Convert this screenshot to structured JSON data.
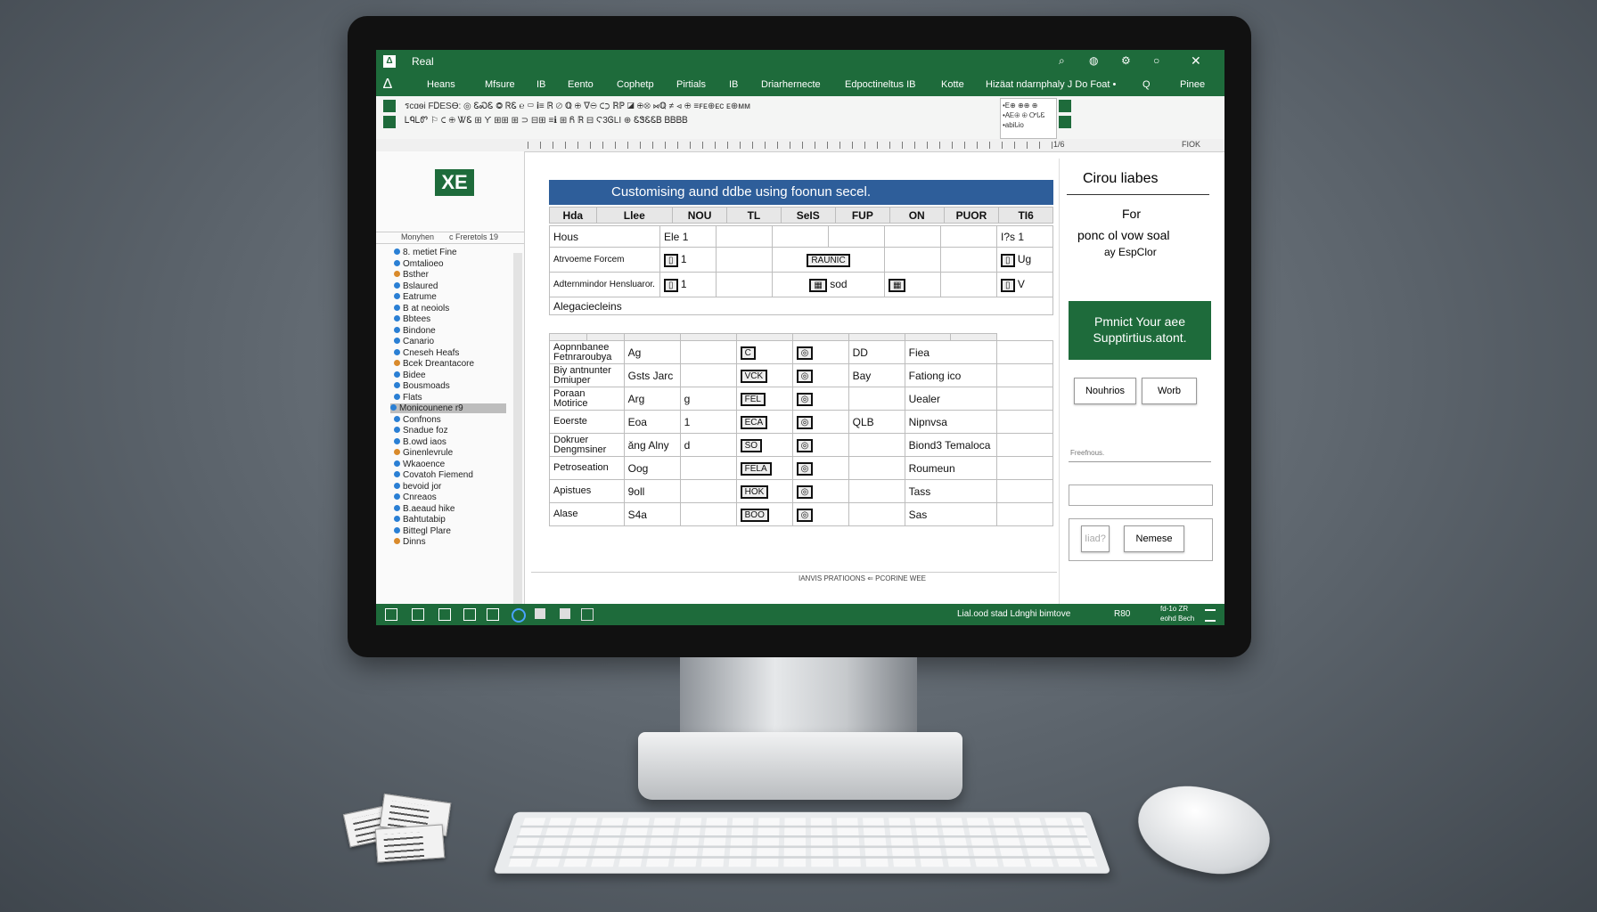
{
  "window": {
    "title": "Real"
  },
  "menu": [
    "Heans",
    "Mfsure",
    "IB",
    "Eento",
    "Cophetp",
    "Pirtials",
    "IB",
    "Driarhernecte",
    "Edpoctineltus IB",
    "Kotte",
    "Hizäat ndarnphaly J Do Foat •",
    "Q",
    "Pinee"
  ],
  "ribbon": {
    "row1": "รсɑѳі  FᎠESѲ:  ◎ ᏋᏍᏋ  ◎  ᏒᏋ  ℮  ▭  ℹ≡  ℝ  ⊘ ℚ  ⊕  ∇⊖  ⊂⊃  ℝℙ  ◪  ⊕⊗  ⋈ℚ  ≠  ⊲  ⊕  ≡ꜰᴇ⊕ᴇᴄ  ᴇ⊕ᴍᴍ",
    "row2": "ᏞᏄᏞᏛ  ⚐ ⊂  ⊕  ᏔᏋ  ⊞  ϒ  ⊞⊞  ⊞  ⊃  ⊟⊞  ≡ℹ  ⊞  Ᏺ  ℝ  ⊟  Ϛ3ᎶLI  ⊕  ᏋᏕᏋᏋᏴ  ᏴᏴᏴᏴ",
    "style_box": "•E⊕ ⊕⊕ ⊕\n•AᎬ⊕ ⊕ ᏅᏓᏋ\n•abiᏓio"
  },
  "ruler": {
    "right_label": "FIOK",
    "mid_label": "1/6"
  },
  "leftpane": {
    "logo": "XE",
    "header_left": "Monyhen",
    "header_right": "c Freretols 19",
    "items": [
      "8. metiet Fine",
      "Omtalioeo",
      "Bsther",
      "Bslaured",
      "Eatrume",
      "B at neoiols",
      "Bbtees",
      "Bindone",
      "Canario",
      "Cneseh Heafs",
      "Bcek Dreantacore",
      "Bidee",
      "Bousmoads",
      "Flats",
      "Monicounene r9",
      "Confnons",
      "Snadue foz",
      "B.owd iaos",
      "Ginenlevrule",
      "Wkaoence",
      "Covatoh Fiemend",
      "bevoid jor",
      "Cnreaos",
      "B.aeaud hike",
      "Bahtutabip",
      "Bittegl Plare",
      "Dinns"
    ]
  },
  "banner": "Customising aund ddbe using foonun secel.",
  "table1": {
    "headers": [
      "Hda",
      "Llee",
      "NOU",
      "TL",
      "SeIS",
      "FUP",
      "ON",
      "PUOR",
      "TI6"
    ],
    "rows": [
      [
        "Hous",
        "Ele",
        "1",
        "",
        "",
        "",
        "",
        "",
        "I?s",
        "1"
      ],
      [
        "Atrvoeme Forcem",
        "",
        "1",
        "RAUNIC",
        "",
        "",
        "",
        "",
        "",
        "Ug"
      ],
      [
        "Adternmindor Hensluaror.",
        "",
        "1",
        "",
        "sod",
        "",
        "",
        "",
        "",
        "V"
      ],
      [
        "Alegaciecleins",
        "",
        "",
        "",
        "",
        "",
        "",
        "",
        "",
        ""
      ]
    ]
  },
  "table2": {
    "rows": [
      [
        "Aopnnbanee Fetnraroubya",
        "Ag",
        "",
        "C",
        "",
        "DD",
        "Fiea"
      ],
      [
        "Biy antnunter Dmiuper",
        "Gsts Jarc",
        "",
        "VCK",
        "",
        "Bay",
        "Fationg ico"
      ],
      [
        "Poraan Motirice",
        "Arg",
        "g",
        "FEL",
        "",
        "",
        "Uealer"
      ],
      [
        "Eoerste",
        "Eoa",
        "1",
        "ECA",
        "",
        "QLB",
        "Nipnvsa"
      ],
      [
        "Dokruer Dengmsiner",
        "ǎng Alny",
        "d",
        "SO",
        "",
        "",
        "Biond3 Temaloca"
      ],
      [
        "Petroseation",
        "Oog",
        "",
        "FELA",
        "",
        "",
        "Roumeun"
      ],
      [
        "Apistues",
        "9oll",
        "",
        "HOK",
        "",
        "",
        "Tass"
      ],
      [
        "Alase",
        "S4a",
        "",
        "BOO",
        "",
        "",
        "Sas"
      ]
    ],
    "footer": "IANVIS PRATIOONS ⇐ PCORINE WEE"
  },
  "rightpanel": {
    "title": "Cirou liabes",
    "for": "For",
    "subtitle": "ponc ol vow soal",
    "subtitle2": "ay EspClor",
    "promo": "Pmnict Your aee Supptirtius.atont.",
    "btn1": "Nouhrios",
    "btn2": "Worb",
    "field_label": "Freefnous.",
    "btn3": "Iiad?",
    "btn4": "Nemese"
  },
  "status": {
    "left_hint": "",
    "right": "Lial.ood stad  Ldnghi bimtove",
    "zoom": "R80",
    "clock1": "fd-1o ZR",
    "clock2": "eohd Bech"
  },
  "colors": {
    "excel_green": "#1e6b3b",
    "banner_blue": "#2e5e9a"
  }
}
